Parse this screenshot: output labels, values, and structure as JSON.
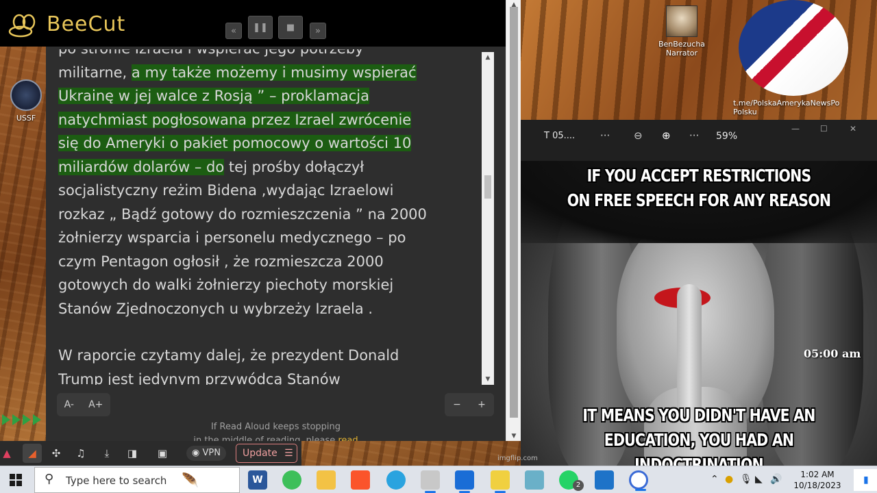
{
  "beecut": {
    "app_name": "BeeCut",
    "rewind_icon": "rewind-icon",
    "pause_icon": "pause-icon",
    "stop_icon": "stop-icon",
    "forward_icon": "fast-forward-icon"
  },
  "desktop": {
    "ussf_label": "USSF",
    "narrator_line1": "BenBezucha",
    "narrator_line2": "Narrator",
    "telegram_line1": "t.me/PolskaAmerykaNewsPo",
    "telegram_line2": "Polsku"
  },
  "reader": {
    "line0": "po stronie Izraela i wspierać jego potrzeby",
    "line1_plain": "militarne, ",
    "line1_hl": "a my także możemy i musimy wspierać",
    "line2_hl": "Ukrainę w jej walce z Rosją ” – proklamacja",
    "line3_hl": "natychmiast pogłosowana przez Izrael zwrócenie",
    "line4_hl": "się do Ameryki o pakiet pomocowy o wartości 10",
    "line5_hl": "miliardów dolarów – do",
    "line5_plain": " tej prośby dołączył",
    "line6": "socjalistyczny reżim Bidena ,wydając Izraelowi",
    "line7": "rozkaz „ Bądź gotowy do rozmieszczenia ” na 2000",
    "line8": "żołnierzy wsparcia i personelu medycznego – po",
    "line9": "czym Pentagon ogłosił , że rozmieszcza 2000",
    "line10": "gotowych do walki żołnierzy piechoty morskiej",
    "line11": "Stanów Zjednoczonych u wybrzeży Izraela .",
    "line12": "W raporcie czytamy dalej, że prezydent Donald",
    "line13": "Trump jest jedynym przywódcą Stanów",
    "font_decrease": "A-",
    "font_increase": "A+",
    "speed_decrease": "−",
    "speed_increase": "+",
    "note_line1": "If Read Aloud keeps stopping",
    "note_line2": "in the middle of reading, please ",
    "note_link": "read"
  },
  "extensions": {
    "vpn_label": "VPN",
    "update_label": "Update"
  },
  "viewer": {
    "title": "T 05....",
    "more1": "···",
    "more2": "···",
    "zoom_out": "⊖",
    "zoom_in": "⊕",
    "zoom_level": "59%",
    "minimize": "—",
    "maximize": "☐",
    "close": "✕"
  },
  "meme": {
    "top_line1": "IF YOU ACCEPT RESTRICTIONS",
    "top_line2": "ON FREE SPEECH FOR ANY REASON",
    "bottom_line1": "IT MEANS YOU DIDN'T HAVE AN",
    "bottom_line2": "EDUCATION, YOU HAD AN INDOCTRINATION",
    "time": "05:00 am",
    "credit": "imgflip.com"
  },
  "taskbar": {
    "search_placeholder": "Type here to search",
    "time": "1:02 AM",
    "date": "10/18/2023",
    "whatsapp_badge": "2",
    "colors": {
      "word": "#2b579a",
      "brave": "#fb542b",
      "telegram": "#2aa3df",
      "whatsapp": "#25d366"
    }
  }
}
